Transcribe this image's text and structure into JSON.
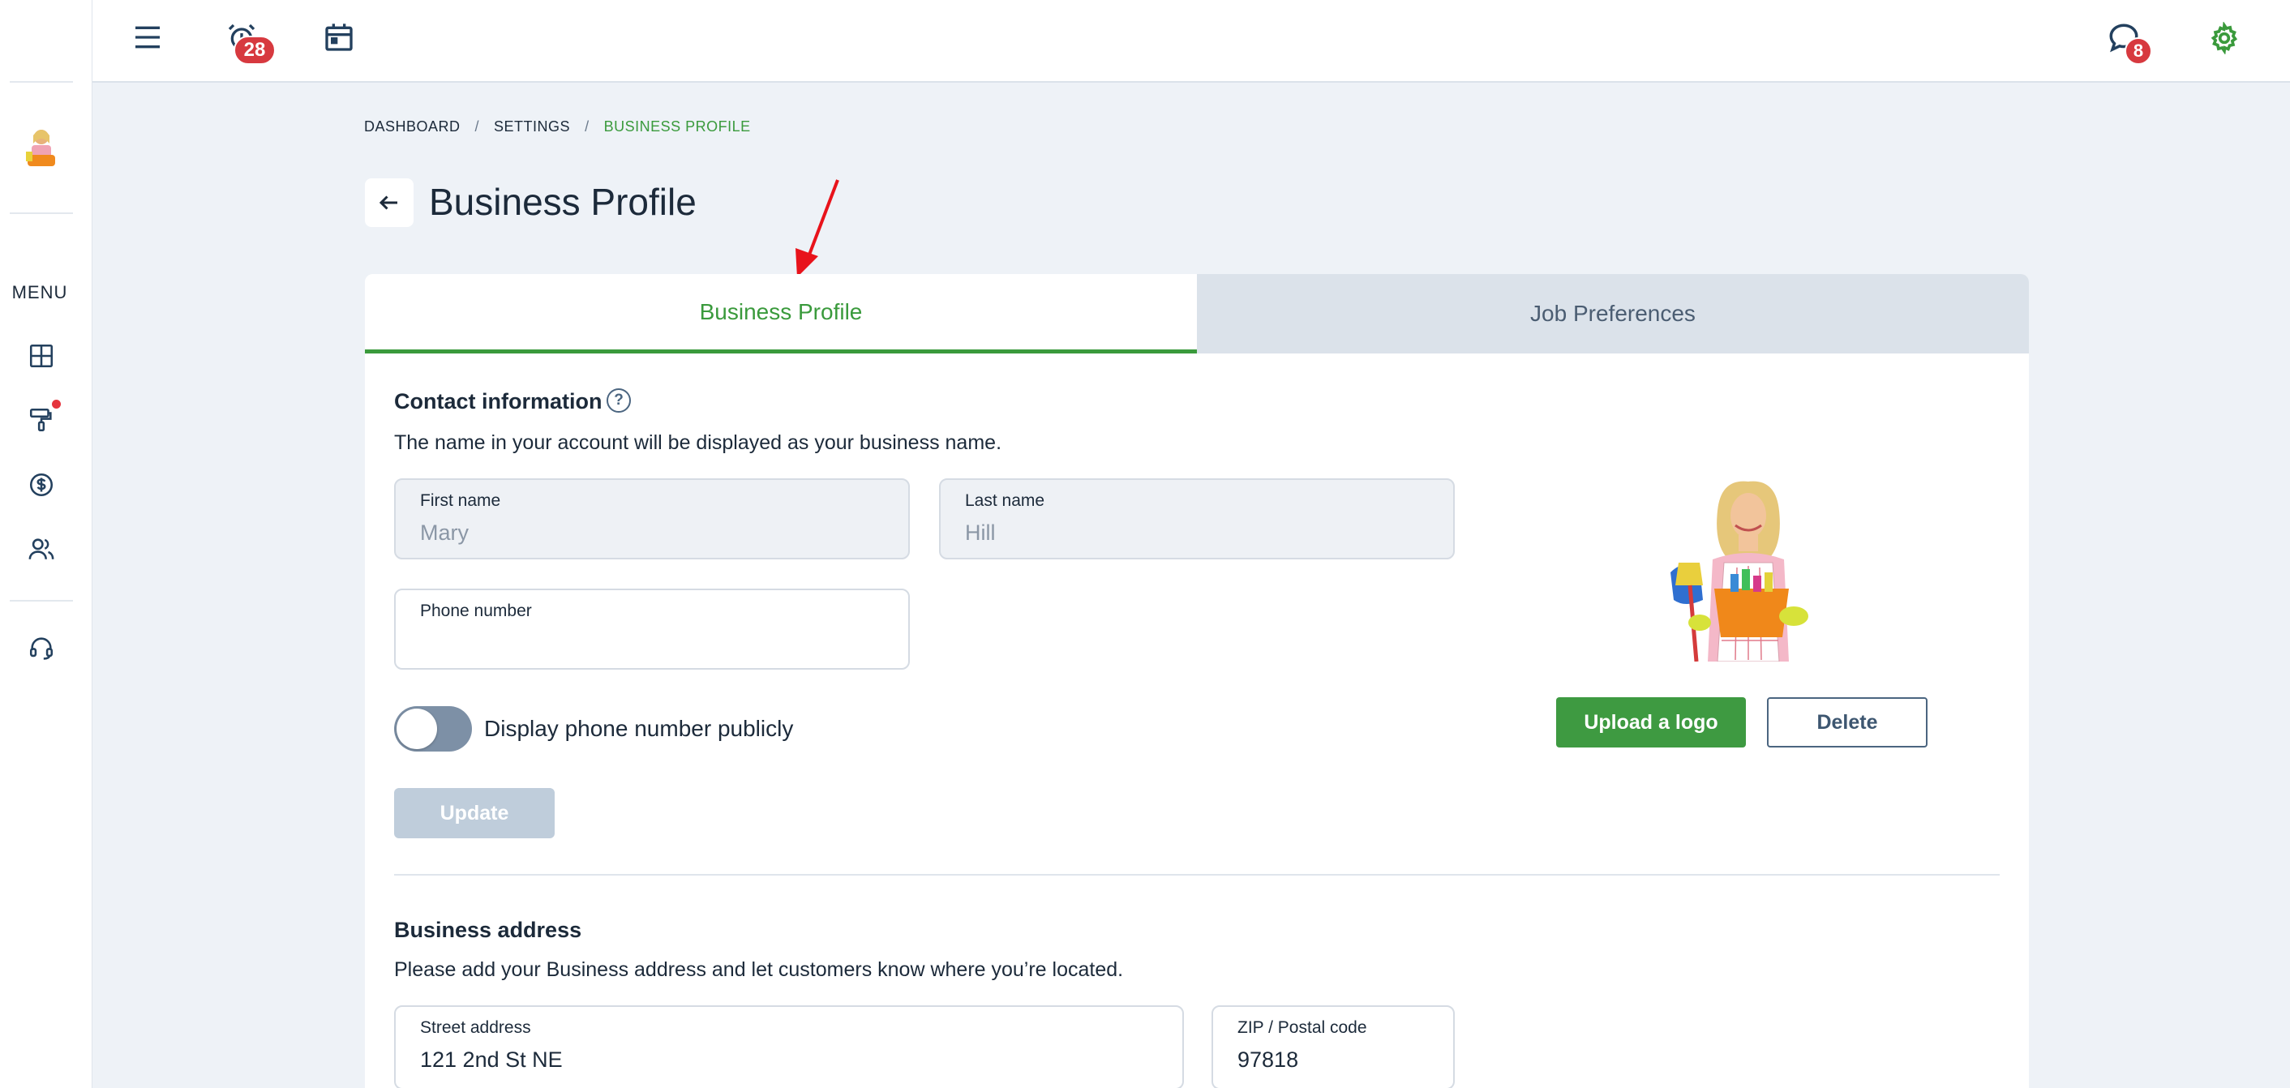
{
  "topbar": {
    "alarm_badge": "28",
    "messages_badge": "8",
    "icons": [
      "hamburger-menu-icon",
      "alarm-clock-icon",
      "calendar-icon",
      "chat-bubble-icon",
      "gear-icon"
    ]
  },
  "sidebar": {
    "menu_label": "MENU",
    "items": [
      {
        "icon": "dashboard-grid-icon"
      },
      {
        "icon": "paint-roller-icon",
        "has_notification": true
      },
      {
        "icon": "dollar-circle-icon"
      },
      {
        "icon": "users-icon"
      },
      {
        "icon": "headset-support-icon"
      }
    ]
  },
  "breadcrumb": {
    "items": [
      "DASHBOARD",
      "SETTINGS",
      "BUSINESS PROFILE"
    ],
    "separator": "/"
  },
  "page": {
    "title": "Business Profile"
  },
  "tabs": [
    {
      "label": "Business Profile",
      "active": true
    },
    {
      "label": "Job Preferences",
      "active": false
    }
  ],
  "contact": {
    "title": "Contact information",
    "help": "?",
    "description": "The name in your account will be displayed as your business name.",
    "first_name_label": "First name",
    "first_name_value": "Mary",
    "last_name_label": "Last name",
    "last_name_value": "Hill",
    "phone_label": "Phone number",
    "phone_value": "",
    "toggle_label": "Display phone number publicly",
    "toggle_on": false,
    "update_label": "Update"
  },
  "logo": {
    "upload_label": "Upload a logo",
    "delete_label": "Delete"
  },
  "address": {
    "title": "Business address",
    "description": "Please add your Business address and let customers know where you’re located.",
    "street_label": "Street address",
    "street_value": "121 2nd St NE",
    "zip_label": "ZIP / Postal code",
    "zip_value": "97818"
  },
  "colors": {
    "brand_green": "#3a9a3c",
    "badge_red": "#d7393f",
    "annotation_red": "#e8131b",
    "background": "#eef2f7"
  }
}
